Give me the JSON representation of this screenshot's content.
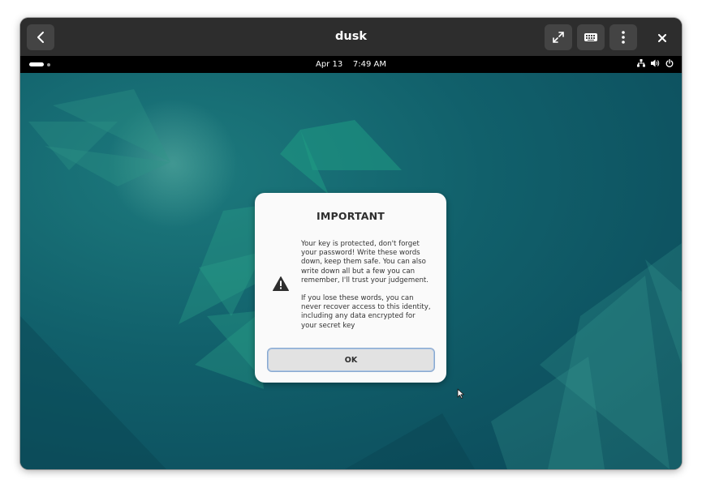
{
  "header": {
    "title": "dusk",
    "back_icon": "chevron-left-icon",
    "fullscreen_icon": "fullscreen-icon",
    "keyboard_icon": "keyboard-icon",
    "menu_icon": "kebab-menu-icon",
    "close_icon": "close-icon"
  },
  "topbar": {
    "date": "Apr 13",
    "time": "7:49 AM",
    "tray_icons": [
      "network-icon",
      "volume-icon",
      "power-icon"
    ]
  },
  "dialog": {
    "title": "IMPORTANT",
    "icon": "warning-icon",
    "paragraph1": "Your key is protected, don't forget your password! Write these words down, keep them safe. You can also write down all but a few you can remember, I'll trust your judgement.",
    "paragraph2": "If you lose these words, you can never recover access to this identity, including any data encrypted for your secret key",
    "ok_label": "OK"
  },
  "colors": {
    "headerbar": "#2d2d2d",
    "header_button": "#444444",
    "desktop_teal": "#0f5a66",
    "dialog_bg": "#fafafa",
    "button_focus": "#8aa9cf"
  }
}
